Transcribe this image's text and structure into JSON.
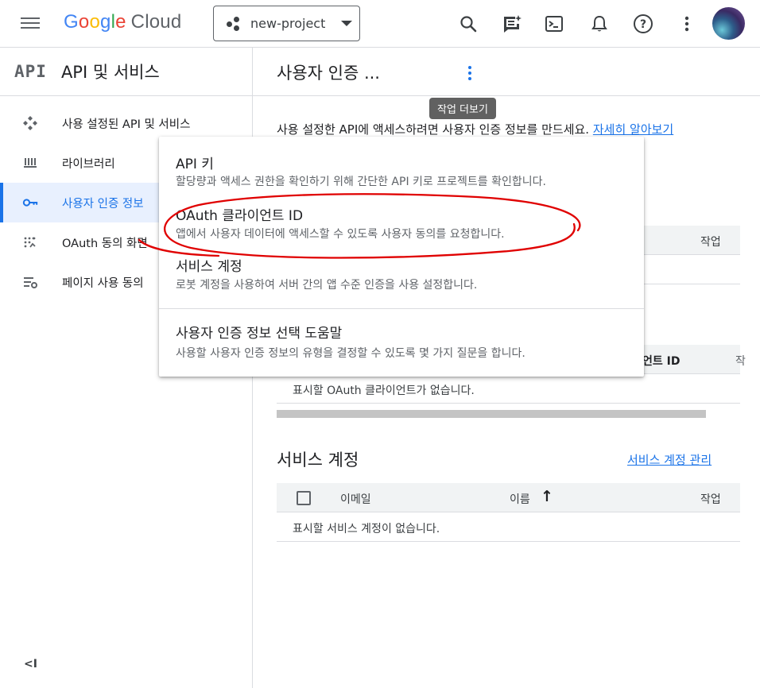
{
  "topbar": {
    "logo_word": "Google",
    "logo_product": "Cloud",
    "project_name": "new-project",
    "icons": [
      "menu-icon",
      "search-icon",
      "gemini-chat-icon",
      "cloud-shell-icon",
      "notifications-icon",
      "help-icon",
      "more-vert-icon"
    ]
  },
  "sidebar": {
    "mark": "API",
    "title": "API 및 서비스",
    "items": [
      {
        "label": "사용 설정된 API 및 서비스",
        "icon": "apis-icon"
      },
      {
        "label": "라이브러리",
        "icon": "library-icon"
      },
      {
        "label": "사용자 인증 정보",
        "icon": "key-icon",
        "active": true
      },
      {
        "label": "OAuth 동의 화면",
        "icon": "oauth-consent-icon"
      },
      {
        "label": "페이지 사용 동의",
        "icon": "page-usage-icon"
      }
    ],
    "collapse_label": "<I"
  },
  "main": {
    "title": "사용자 인증 ...",
    "tooltip": "작업 더보기",
    "intro": "사용 설정한 API에 액세스하려면 사용자 인증 정보를 만드세요.",
    "intro_link": "자세히 알아보기",
    "api_keys_table": {
      "action_header": "작업"
    },
    "oauth_table": {
      "col_header_partial": "언트 ID",
      "col_cut": "작",
      "empty": "표시할 OAuth 클라이언트가 없습니다."
    },
    "service_accounts": {
      "title": "서비스 계정",
      "manage_link": "서비스 계정 관리",
      "columns": [
        "이메일",
        "이름",
        "작업"
      ],
      "sort_arrow": "↑",
      "empty": "표시할 서비스 계정이 없습니다."
    }
  },
  "menu": {
    "items": [
      {
        "title": "API 키",
        "desc": "할당량과 액세스 권한을 확인하기 위해 간단한 API 키로 프로젝트를 확인합니다."
      },
      {
        "title": "OAuth 클라이언트 ID",
        "desc": "앱에서 사용자 데이터에 액세스할 수 있도록 사용자 동의를 요청합니다."
      },
      {
        "title": "서비스 계정",
        "desc": "로봇 계정을 사용하여 서버 간의 앱 수준 인증을 사용 설정합니다."
      },
      {
        "title": "사용자 인증 정보 선택 도움말",
        "desc": "사용할 사용자 인증 정보의 유형을 결정할 수 있도록 몇 가지 질문을 합니다."
      }
    ]
  },
  "colors": {
    "accent": "#1a73e8",
    "annotation": "#e00000",
    "active_bg": "#e8f0fe"
  }
}
